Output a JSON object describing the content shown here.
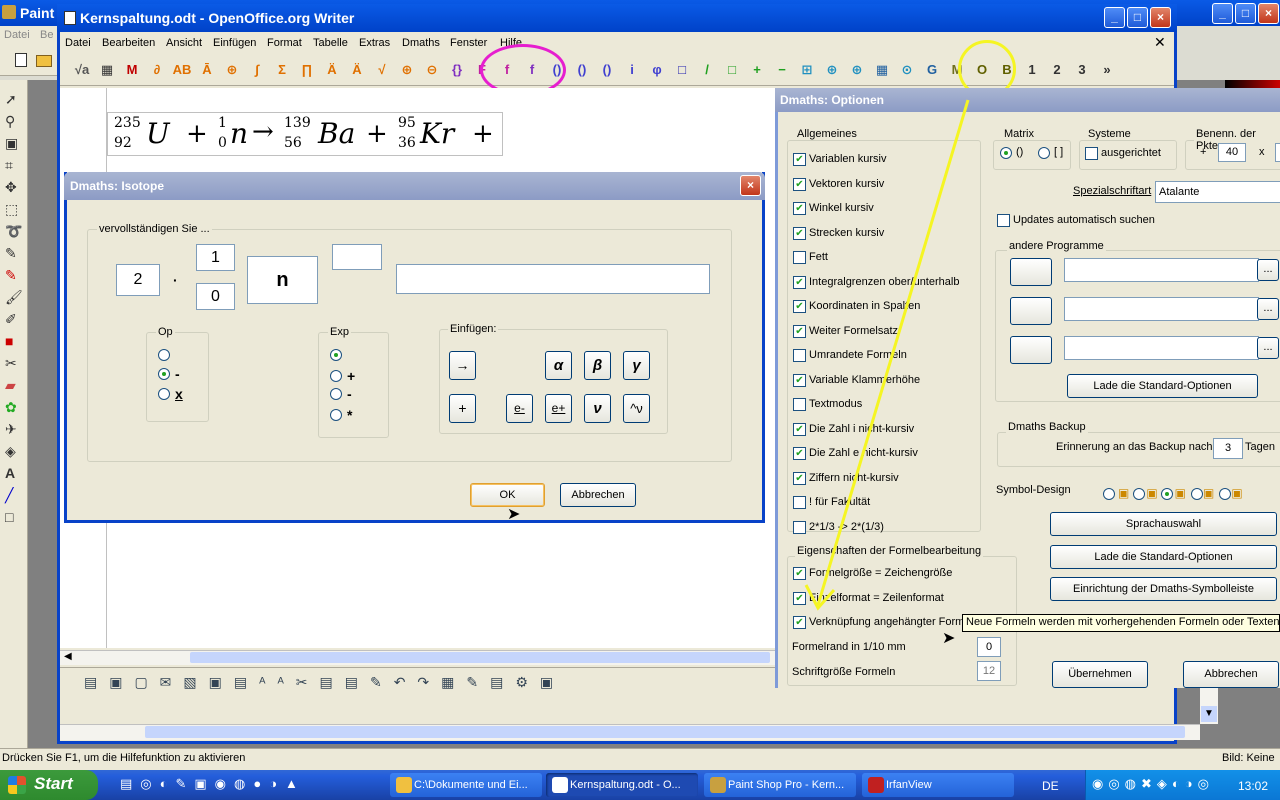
{
  "psp": {
    "title": "Paint",
    "menu": [
      "Datei",
      "Be"
    ],
    "status": "Drücken Sie F1, um die Hilfefunktion zu aktivieren",
    "status_right": "Bild: Keine"
  },
  "writer": {
    "title": "Kernspaltung.odt - OpenOffice.org Writer",
    "menu": [
      "Datei",
      "Bearbeiten",
      "Ansicht",
      "Einfügen",
      "Format",
      "Tabelle",
      "Extras",
      "Dmaths",
      "Fenster",
      "Hilfe"
    ]
  },
  "formula": {
    "a1": "235",
    "z1": "92",
    "s1": "U",
    "a2": "1",
    "z2": "0",
    "s2": "n",
    "a3": "139",
    "z3": "56",
    "s3": "Ba",
    "a4": "95",
    "z4": "36",
    "s4": "Kr",
    "plus": "+",
    "arrow": "→"
  },
  "toolbar_glyphs": [
    "√a",
    "▦",
    "M",
    "∂",
    "AB",
    "Ā",
    "⊕",
    "∫",
    "Σ",
    "∏",
    "Ä",
    "Ä",
    "√",
    "⊕",
    "⊖",
    "{}",
    "F",
    "f",
    "f",
    "()",
    "()",
    "()",
    "i",
    "φ",
    "□",
    "/",
    "□",
    "+",
    "−",
    "⊞",
    "⊕",
    "⊕",
    "▦",
    "⊙",
    "G",
    "M",
    "O",
    "B",
    "1",
    "2",
    "3",
    "»"
  ],
  "isotope": {
    "title": "Dmaths: Isotope",
    "group": "vervollständigen Sie ...",
    "field_coef": "2",
    "field_dot": "·",
    "field_top": "1",
    "field_bottom": "0",
    "field_symbol": "n",
    "op": {
      "title": "Op",
      "opt_minus": "-",
      "opt_x": "x"
    },
    "exp": {
      "title": "Exp",
      "opt_plus": "+",
      "opt_minus": "-",
      "opt_star": "*"
    },
    "ins": {
      "title": "Einfügen:",
      "arrow": "→",
      "alpha": "α",
      "beta": "β",
      "gamma": "γ",
      "plus": "+",
      "eminus": "e-",
      "eplus": "e+",
      "nu": "ν",
      "hat_nu": "^ν"
    },
    "ok": "OK",
    "cancel": "Abbrechen"
  },
  "options": {
    "title": "Dmaths: Optionen",
    "general": "Allgemeines",
    "checks": [
      {
        "label": "Variablen kursiv",
        "on": true
      },
      {
        "label": "Vektoren kursiv",
        "on": true
      },
      {
        "label": "Winkel kursiv",
        "on": true
      },
      {
        "label": "Strecken kursiv",
        "on": true
      },
      {
        "label": "Fett",
        "on": false
      },
      {
        "label": "Integralgrenzen ober/unterhalb",
        "on": true
      },
      {
        "label": "Koordinaten in Spalten",
        "on": true
      },
      {
        "label": "Weiter Formelsatz",
        "on": true
      },
      {
        "label": "Umrandete Formeln",
        "on": false
      },
      {
        "label": "Variable Klammerhöhe",
        "on": true
      },
      {
        "label": "Textmodus",
        "on": false
      },
      {
        "label": "Die Zahl  i nicht-kursiv",
        "on": true
      },
      {
        "label": "Die Zahl  e nicht-kursiv",
        "on": true
      },
      {
        "label": "Ziffern nicht-kursiv",
        "on": true
      },
      {
        "label": "! für Fakultät",
        "on": false
      },
      {
        "label": "2*1/3 -> 2*(1/3)",
        "on": false
      }
    ],
    "matrix": "Matrix",
    "matrix_opt1": "()",
    "matrix_opt2": "[ ]",
    "systeme": "Systeme",
    "ausgerichtet": "ausgerichtet",
    "benenn": "Benenn. der Pkte",
    "benenn_plus": "+",
    "benenn_val": "40",
    "benenn_x": "x",
    "spezial_label": "Spezialschriftart",
    "spezial_val": "Atalante",
    "updates": "Updates automatisch suchen",
    "andere": "andere Programme",
    "lade1": "Lade die Standard-Optionen",
    "ellipsis": "...",
    "backup": "Dmaths Backup",
    "backup_text": "Erinnerung an das Backup nach",
    "backup_val": "3",
    "backup_unit": "Tagen",
    "symbol_design": "Symbol-Design",
    "sprach": "Sprachauswahl",
    "lade2": "Lade die Standard-Optionen",
    "einrichtung": "Einrichtung der Dmaths-Symbolleiste",
    "eigen": "Eigenschaften der Formelbearbeitung",
    "eigen_checks": [
      {
        "label": "Formelgröße = Zeichengröße",
        "on": true
      },
      {
        "label": "Einzelformat = Zeilenformat",
        "on": true
      },
      {
        "label": "Verknüpfung angehängter Form",
        "on": true
      }
    ],
    "formelrand": "Formelrand in 1/10 mm",
    "formelrand_val": "0",
    "schrift": "Schriftgröße Formeln",
    "schrift_val": "12",
    "tooltip": "Neue Formeln werden mit vorhergehenden Formeln oder Texten v",
    "apply": "Übernehmen",
    "cancel": "Abbrechen"
  },
  "taskbar": {
    "start": "Start",
    "tasks": [
      "C:\\Dokumente und Ei...",
      "Kernspaltung.odt - O...",
      "Paint Shop Pro - Kern...",
      "IrfanView"
    ],
    "lang": "DE",
    "time": "13:02"
  },
  "colors": {
    "xp_blue": "#0a246a",
    "annot_magenta": "#e61ecf",
    "annot_yellow": "#f5f523"
  }
}
